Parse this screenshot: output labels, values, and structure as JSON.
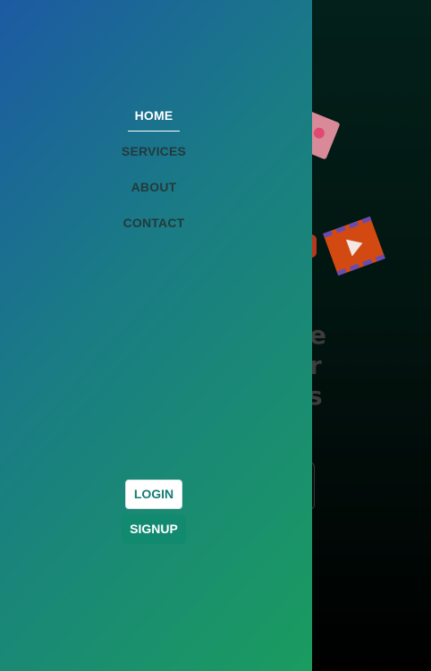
{
  "nav": {
    "items": [
      {
        "label": "HOME",
        "active": true
      },
      {
        "label": "SERVICES",
        "active": false
      },
      {
        "label": "ABOUT",
        "active": false
      },
      {
        "label": "CONTACT",
        "active": false
      }
    ]
  },
  "auth": {
    "login_label": "LOGIN",
    "signup_label": "SIGNUP"
  },
  "hero": {
    "lines": [
      "e",
      "r",
      "s"
    ]
  },
  "colors": {
    "drawer_start": "#1c5aa3",
    "drawer_end": "#1a9c5f",
    "login_text": "#147c72",
    "signup_bg": "#128a70",
    "background": "#021510"
  },
  "icons": {
    "photo": "image-sticker-icon",
    "film": "video-film-icon"
  }
}
